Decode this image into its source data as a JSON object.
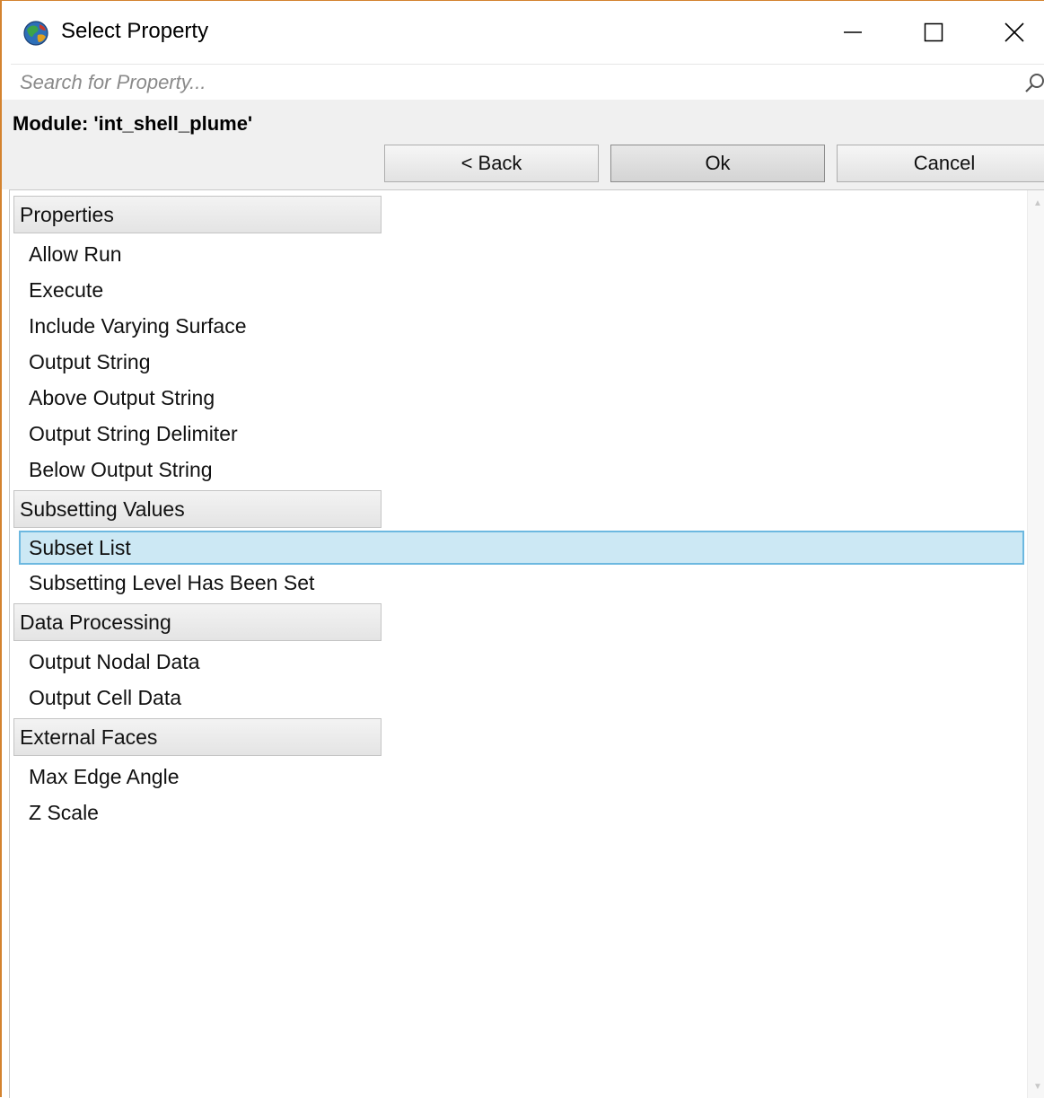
{
  "window": {
    "title": "Select Property",
    "icon": "app-globe-icon",
    "controls": [
      "minimize-icon",
      "maximize-icon",
      "close-icon"
    ]
  },
  "search": {
    "placeholder": "Search for Property...",
    "value": "",
    "icon": "search-icon"
  },
  "module_label": "Module: 'int_shell_plume'",
  "buttons": {
    "back": "< Back",
    "ok": "Ok",
    "cancel": "Cancel"
  },
  "groups": [
    {
      "label": "Properties",
      "items": [
        "Allow Run",
        "Execute",
        "Include Varying Surface",
        "Output String",
        "Above Output String",
        "Output String Delimiter",
        "Below Output String"
      ]
    },
    {
      "label": "Subsetting Values",
      "items": [
        "Subset List",
        "Subsetting Level Has Been Set"
      ]
    },
    {
      "label": "Data Processing",
      "items": [
        "Output Nodal Data",
        "Output Cell Data"
      ]
    },
    {
      "label": "External Faces",
      "items": [
        "Max Edge Angle",
        "Z Scale"
      ]
    }
  ],
  "selected_item": "Subset List",
  "colors": {
    "window_border": "#d4832f",
    "selection_fill": "#cce8f4",
    "selection_border": "#6cb8e0"
  }
}
